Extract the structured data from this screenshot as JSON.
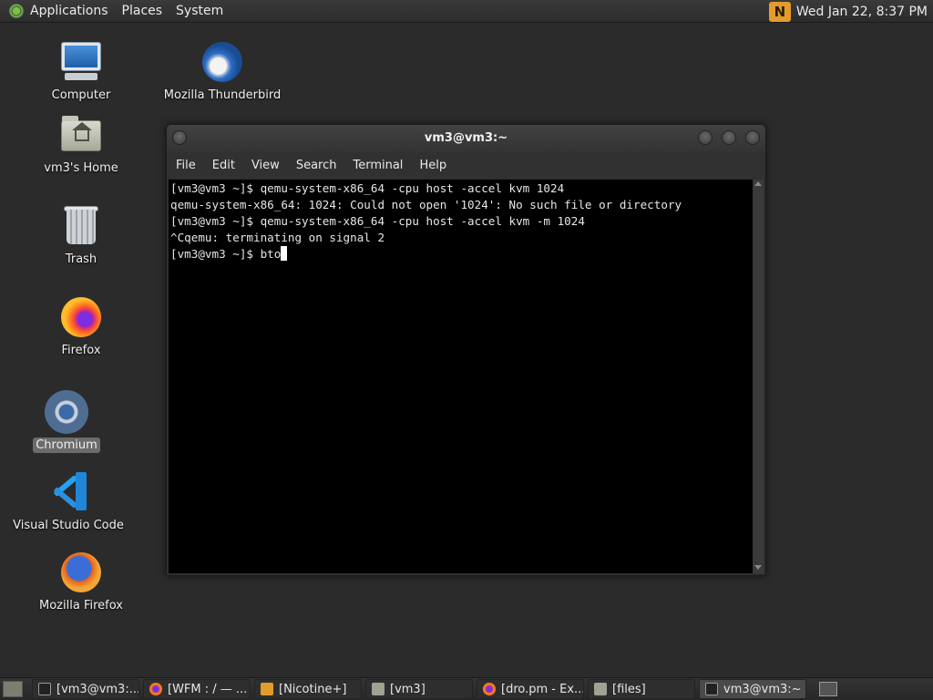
{
  "top_panel": {
    "menus": [
      "Applications",
      "Places",
      "System"
    ],
    "clock": "Wed Jan 22,  8:37 PM",
    "tray_icon": "nicotine-plus-icon"
  },
  "desktop": {
    "icons": [
      {
        "label": "Computer",
        "icon": "computer-icon"
      },
      {
        "label": "vm3's Home",
        "icon": "home-folder-icon"
      },
      {
        "label": "Trash",
        "icon": "trash-icon"
      },
      {
        "label": "Firefox",
        "icon": "firefox-icon"
      },
      {
        "label": "Chromium",
        "icon": "chromium-icon",
        "selected": true
      },
      {
        "label": "Visual Studio Code",
        "icon": "vscode-icon"
      },
      {
        "label": "Mozilla Firefox",
        "icon": "mozilla-firefox-icon"
      },
      {
        "label": "Mozilla Thunderbird",
        "icon": "thunderbird-icon"
      }
    ]
  },
  "terminal": {
    "title": "vm3@vm3:~",
    "menu": [
      "File",
      "Edit",
      "View",
      "Search",
      "Terminal",
      "Help"
    ],
    "lines": [
      "[vm3@vm3 ~]$ qemu-system-x86_64 -cpu host -accel kvm 1024",
      "qemu-system-x86_64: 1024: Could not open '1024': No such file or directory",
      "[vm3@vm3 ~]$ qemu-system-x86_64 -cpu host -accel kvm -m 1024",
      "^Cqemu: terminating on signal 2",
      "[vm3@vm3 ~]$ bto"
    ]
  },
  "taskbar": {
    "tasks": [
      {
        "label": "[vm3@vm3:...",
        "icon": "terminal-icon"
      },
      {
        "label": "[WFM : / — ...",
        "icon": "firefox-icon"
      },
      {
        "label": "[Nicotine+]",
        "icon": "nicotine-icon"
      },
      {
        "label": "[vm3]",
        "icon": "folder-icon"
      },
      {
        "label": "[dro.pm - Ex...",
        "icon": "firefox-icon"
      },
      {
        "label": "[files]",
        "icon": "folder-icon"
      },
      {
        "label": "vm3@vm3:~",
        "icon": "terminal-icon",
        "active": true
      }
    ]
  }
}
